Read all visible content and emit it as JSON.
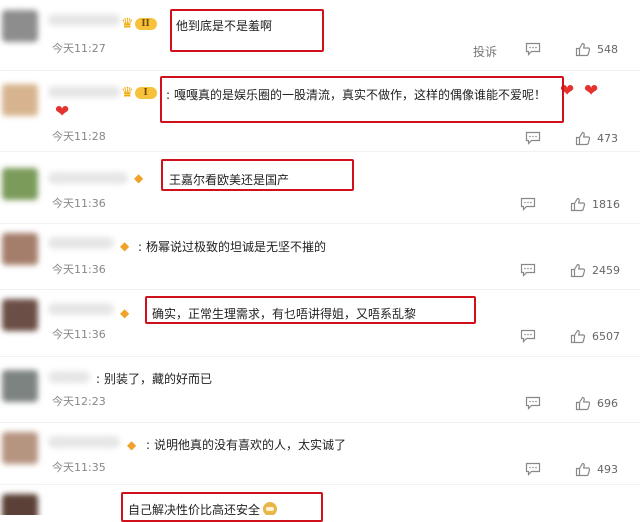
{
  "comments": [
    {
      "text": "他到底是不是羞啊",
      "time": "今天11:27",
      "level": "II",
      "badge": "crown",
      "report": "投诉",
      "likes": "548",
      "avatar_color": "#8d8d8d",
      "hearts": []
    },
    {
      "text": "嘎嘎真的是娱乐圈的一股清流，真实不做作，这样的偶像谁能不爱呢！",
      "time": "今天11:28",
      "level": "I",
      "badge": "crown",
      "likes": "473",
      "avatar_color": "#d7b48f",
      "hearts": [
        "heart",
        "heart",
        "heart"
      ]
    },
    {
      "text": "王嘉尔看欧美还是国产",
      "time": "今天11:36",
      "badge": "medal",
      "likes": "1816",
      "avatar_color": "#7a9b5a",
      "hearts": []
    },
    {
      "text": "杨幂说过极致的坦诚是无坚不摧的",
      "time": "今天11:36",
      "badge": "medal",
      "likes": "2459",
      "avatar_color": "#a57d6b",
      "hearts": []
    },
    {
      "text": "确实，正常生理需求，有乜唔讲得姐，又唔系乱黎",
      "time": "今天11:36",
      "badge": "medal",
      "likes": "6507",
      "avatar_color": "#6b4e45",
      "hearts": []
    },
    {
      "text": "别装了，藏的好而已",
      "time": "今天12:23",
      "badge": "none",
      "likes": "696",
      "avatar_color": "#7d8380",
      "hearts": []
    },
    {
      "text": "说明他真的没有喜欢的人，太实诚了",
      "time": "今天11:35",
      "badge": "medal",
      "likes": "493",
      "avatar_color": "#b69580",
      "hearts": []
    },
    {
      "text": "自己解决性价比高还安全",
      "time": "",
      "badge": "none",
      "likes": "",
      "avatar_color": "#5a4036",
      "hearts": []
    }
  ],
  "colors": {
    "highlight_box": "#d0101a",
    "time": "#888888",
    "badge": "#f1a22c"
  }
}
